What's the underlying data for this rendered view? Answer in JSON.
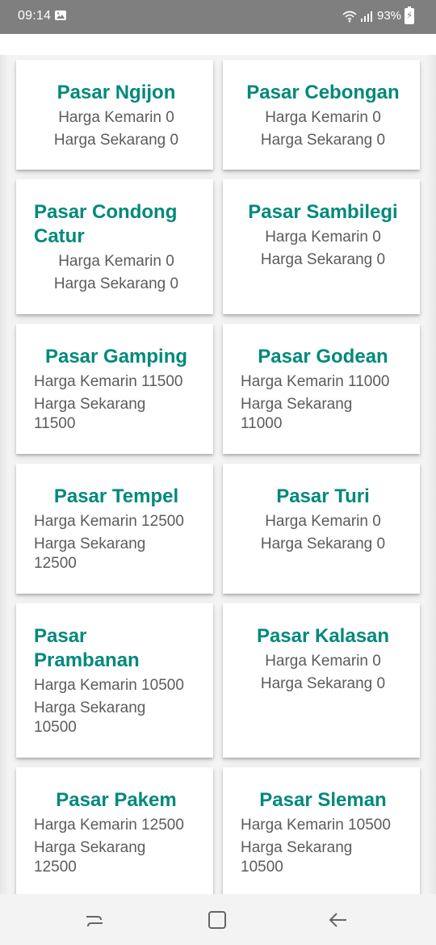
{
  "status_bar": {
    "time": "09:14",
    "battery": "93%",
    "icons": [
      "gallery-icon",
      "wifi-icon",
      "signal-icon",
      "battery-icon"
    ]
  },
  "colors": {
    "accent": "#00897b",
    "status_bar": "#7f7f7f",
    "nav_bar": "#f3f3f3",
    "card": "#ffffff"
  },
  "markets": [
    {
      "name": "Pasar Ngijon",
      "kemarin": "Harga Kemarin 0",
      "sekarang": "Harga Sekarang 0"
    },
    {
      "name": "Pasar Cebongan",
      "kemarin": "Harga Kemarin 0",
      "sekarang": "Harga Sekarang 0"
    },
    {
      "name": "Pasar Condong Catur",
      "kemarin": "Harga Kemarin 0",
      "sekarang": "Harga Sekarang 0"
    },
    {
      "name": "Pasar Sambilegi",
      "kemarin": "Harga Kemarin 0",
      "sekarang": "Harga Sekarang 0"
    },
    {
      "name": "Pasar Gamping",
      "kemarin": "Harga Kemarin 11500",
      "sekarang": "Harga Sekarang 11500"
    },
    {
      "name": "Pasar Godean",
      "kemarin": "Harga Kemarin 11000",
      "sekarang": "Harga Sekarang 11000"
    },
    {
      "name": "Pasar Tempel",
      "kemarin": "Harga Kemarin 12500",
      "sekarang": "Harga Sekarang 12500"
    },
    {
      "name": "Pasar Turi",
      "kemarin": "Harga Kemarin 0",
      "sekarang": "Harga Sekarang 0"
    },
    {
      "name": "Pasar Prambanan",
      "kemarin": "Harga Kemarin 10500",
      "sekarang": "Harga Sekarang 10500"
    },
    {
      "name": "Pasar Kalasan",
      "kemarin": "Harga Kemarin 0",
      "sekarang": "Harga Sekarang 0"
    },
    {
      "name": "Pasar Pakem",
      "kemarin": "Harga Kemarin 12500",
      "sekarang": "Harga Sekarang 12500"
    },
    {
      "name": "Pasar Sleman",
      "kemarin": "Harga Kemarin 10500",
      "sekarang": "Harga Sekarang 10500"
    }
  ],
  "nav": {
    "icons": [
      "recent-apps-icon",
      "home-icon",
      "back-icon"
    ]
  }
}
